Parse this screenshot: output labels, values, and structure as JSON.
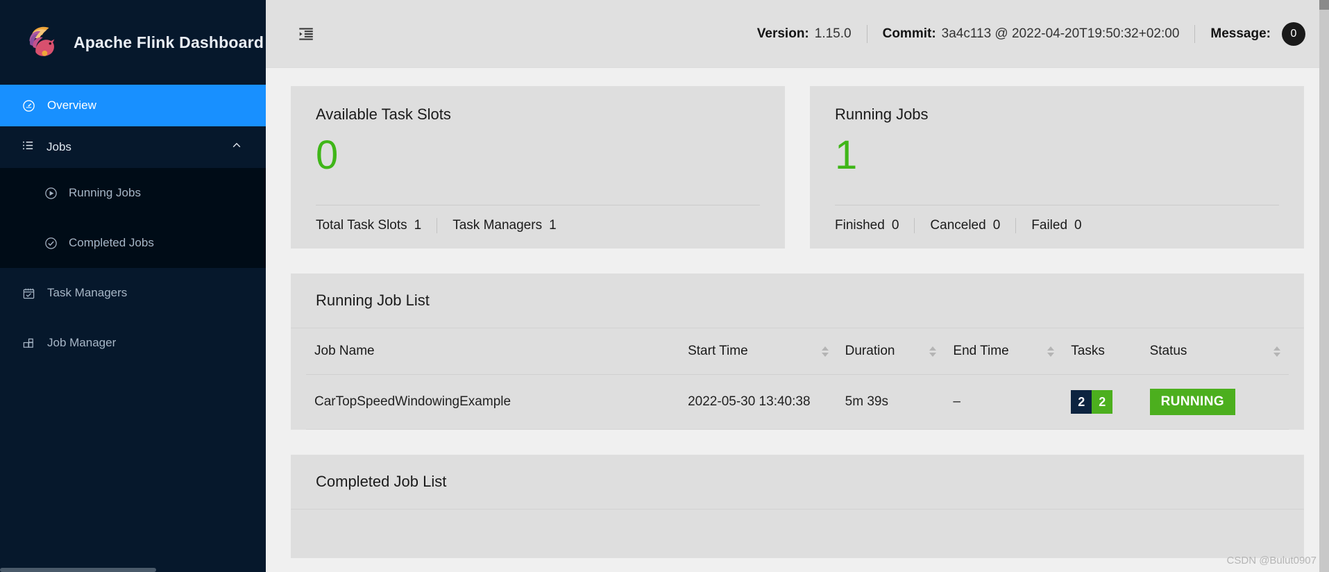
{
  "brand": {
    "title": "Apache Flink Dashboard",
    "logo_icon": "flink-squirrel-logo"
  },
  "sidebar": {
    "items": [
      {
        "label": "Overview",
        "icon": "dashboard-icon",
        "active": true
      },
      {
        "label": "Jobs",
        "icon": "list-icon",
        "expanded": true,
        "chevron": "chevron-up-icon"
      },
      {
        "label": "Running Jobs",
        "icon": "play-circle-icon"
      },
      {
        "label": "Completed Jobs",
        "icon": "check-circle-icon"
      },
      {
        "label": "Task Managers",
        "icon": "calendar-check-icon"
      },
      {
        "label": "Job Manager",
        "icon": "blocks-icon"
      }
    ]
  },
  "topbar": {
    "fold_icon": "menu-fold-icon",
    "version_label": "Version:",
    "version_value": "1.15.0",
    "commit_label": "Commit:",
    "commit_value": "3a4c113 @ 2022-04-20T19:50:32+02:00",
    "message_label": "Message:",
    "message_count": "0"
  },
  "cards": {
    "task_slots": {
      "title": "Available Task Slots",
      "value": "0",
      "foot": [
        {
          "label": "Total Task Slots",
          "value": "1"
        },
        {
          "label": "Task Managers",
          "value": "1"
        }
      ]
    },
    "running_jobs": {
      "title": "Running Jobs",
      "value": "1",
      "foot": [
        {
          "label": "Finished",
          "value": "0"
        },
        {
          "label": "Canceled",
          "value": "0"
        },
        {
          "label": "Failed",
          "value": "0"
        }
      ]
    }
  },
  "running_job_list": {
    "title": "Running Job List",
    "columns": [
      {
        "label": "Job Name",
        "sortable": false
      },
      {
        "label": "Start Time",
        "sortable": true
      },
      {
        "label": "Duration",
        "sortable": true
      },
      {
        "label": "End Time",
        "sortable": true
      },
      {
        "label": "Tasks",
        "sortable": false
      },
      {
        "label": "Status",
        "sortable": true
      }
    ],
    "rows": [
      {
        "job_name": "CarTopSpeedWindowingExample",
        "start_time": "2022-05-30 13:40:38",
        "duration": "5m 39s",
        "end_time": "–",
        "tasks": {
          "pending": "2",
          "running": "2"
        },
        "status": "RUNNING"
      }
    ]
  },
  "completed_job_list": {
    "title": "Completed Job List"
  },
  "watermark": "CSDN @Bulut0907",
  "colors": {
    "accent": "#1890ff",
    "sidebar_bg": "#06182c",
    "submenu_bg": "#000c17",
    "success_green": "#4caf1e",
    "metric_green": "#3fb618",
    "task_dark": "#0d2440"
  }
}
